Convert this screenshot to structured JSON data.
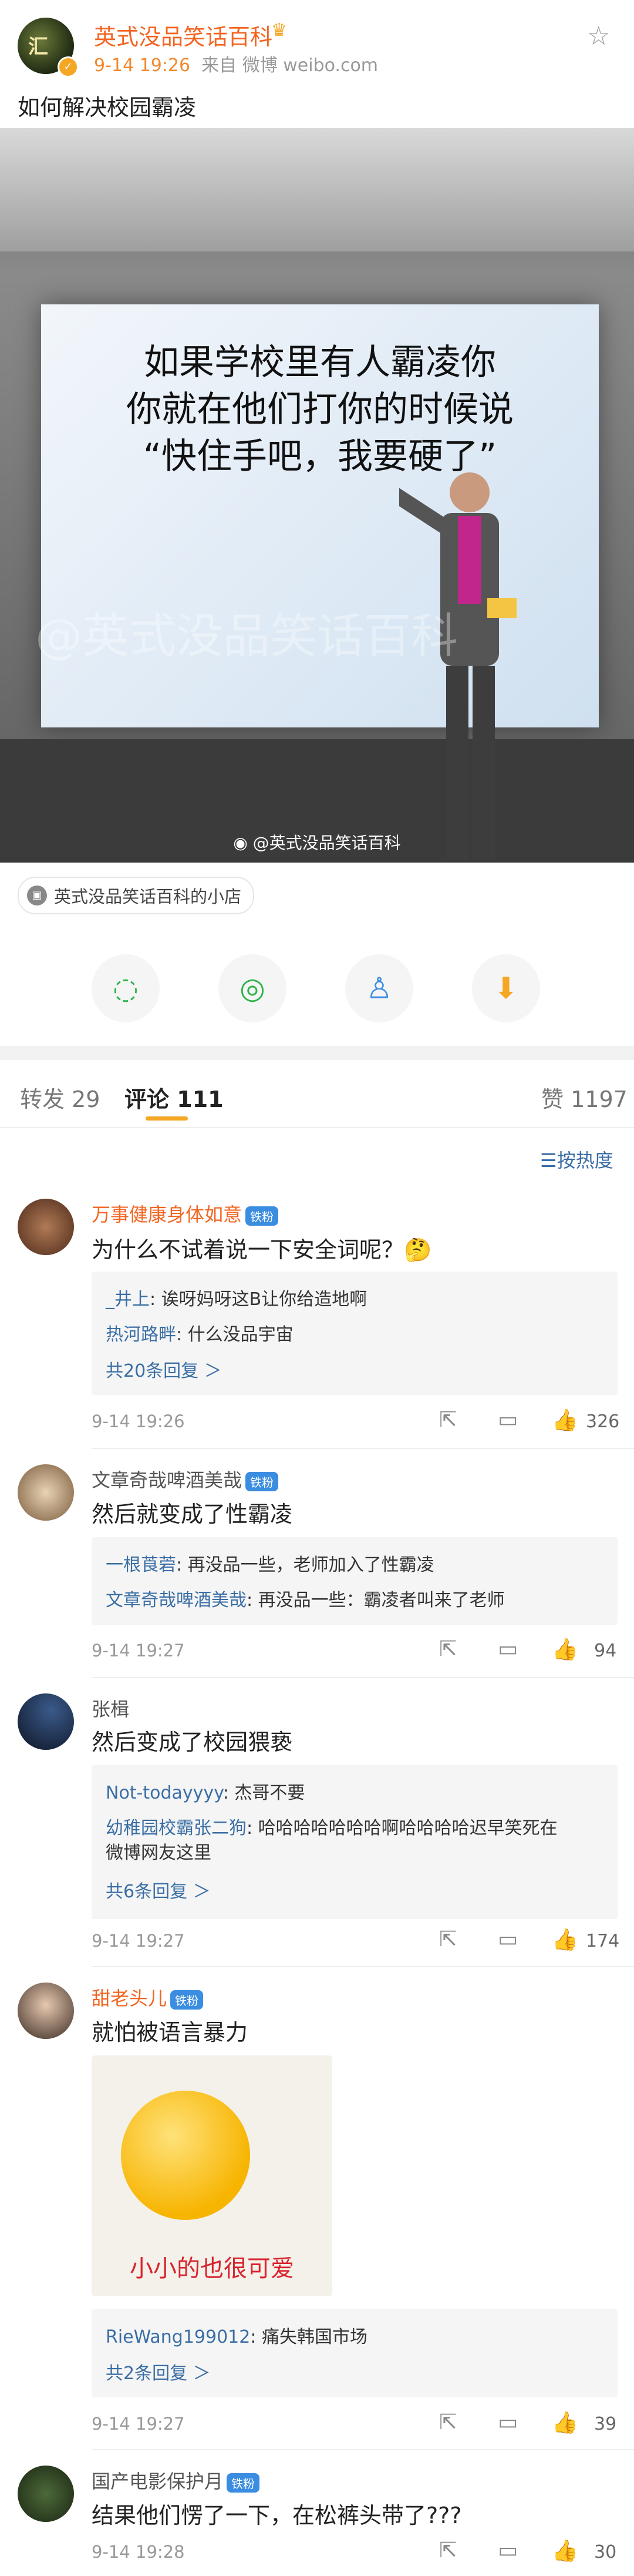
{
  "post": {
    "author": "英式没品笑话百科",
    "time": "9-14 19:26",
    "source": "来自 微博 weibo.com",
    "text": "如何解决校园霸凌",
    "meme_lines": [
      "如果学校里有人霸凌你",
      "你就在他们打你的时候说",
      "“快住手吧，我要硬了”"
    ],
    "watermark": "@英式没品笑话百科",
    "photo_credit": "@英式没品笑话百科",
    "shop_label": "英式没品笑话百科的小店"
  },
  "share_icons": [
    "wechat-icon",
    "moments-icon",
    "qq-icon",
    "save-icon"
  ],
  "tabs": {
    "repost_label": "转发",
    "repost_count": "29",
    "comment_label": "评论",
    "comment_count": "111",
    "like_label": "赞",
    "like_count": "1197",
    "sort_label": "按热度"
  },
  "comments": [
    {
      "name": "万事健康身体如意",
      "badge": "铁粉",
      "text": "为什么不试着说一下安全词呢？🤔",
      "replies": [
        {
          "name": "_井上",
          "text": ": 诶呀妈呀这B让你给造地啊"
        },
        {
          "name": "热河路畔",
          "text": ": 什么没品宇宙"
        }
      ],
      "more": "共20条回复 ＞",
      "time": "9-14 19:26",
      "likes": "326"
    },
    {
      "name": "文章奇哉啤酒美哉",
      "badge": "铁粉",
      "text": "然后就变成了性霸凌",
      "replies": [
        {
          "name": "一根莨菪",
          "text": ": 再没品一些，老师加入了性霸凌"
        },
        {
          "name": "文章奇哉啤酒美哉",
          "text": ": 再没品一些：霸凌者叫来了老师"
        }
      ],
      "time": "9-14 19:27",
      "likes": "94"
    },
    {
      "name": "张楫",
      "text": "然后变成了校园猥亵",
      "replies": [
        {
          "name": "Not-todayyyy",
          "text": ": 杰哥不要"
        },
        {
          "name": "幼稚园校霸张二狗",
          "text": ": 哈哈哈哈哈哈哈啊哈哈哈哈迟早笑死在"
        },
        {
          "name": "",
          "text": "微博网友这里"
        }
      ],
      "more": "共6条回复 ＞",
      "time": "9-14 19:27",
      "likes": "174"
    },
    {
      "name": "甜老头儿",
      "badge": "铁粉",
      "text": "就怕被语言暴力",
      "sticker_text": "小小的也很可爱",
      "replies": [
        {
          "name": "RieWang199012",
          "text": ": 痛失韩国市场"
        }
      ],
      "more": "共2条回复 ＞",
      "time": "9-14 19:27",
      "likes": "39"
    },
    {
      "name": "国产电影保护月",
      "badge": "铁粉",
      "text": "结果他们愣了一下，在松裤头带了???",
      "time": "9-14 19:28",
      "likes": "30"
    }
  ],
  "colors": {
    "accent": "#f26522",
    "link": "#3a6ea5",
    "tab_underline": "#f5a623"
  }
}
